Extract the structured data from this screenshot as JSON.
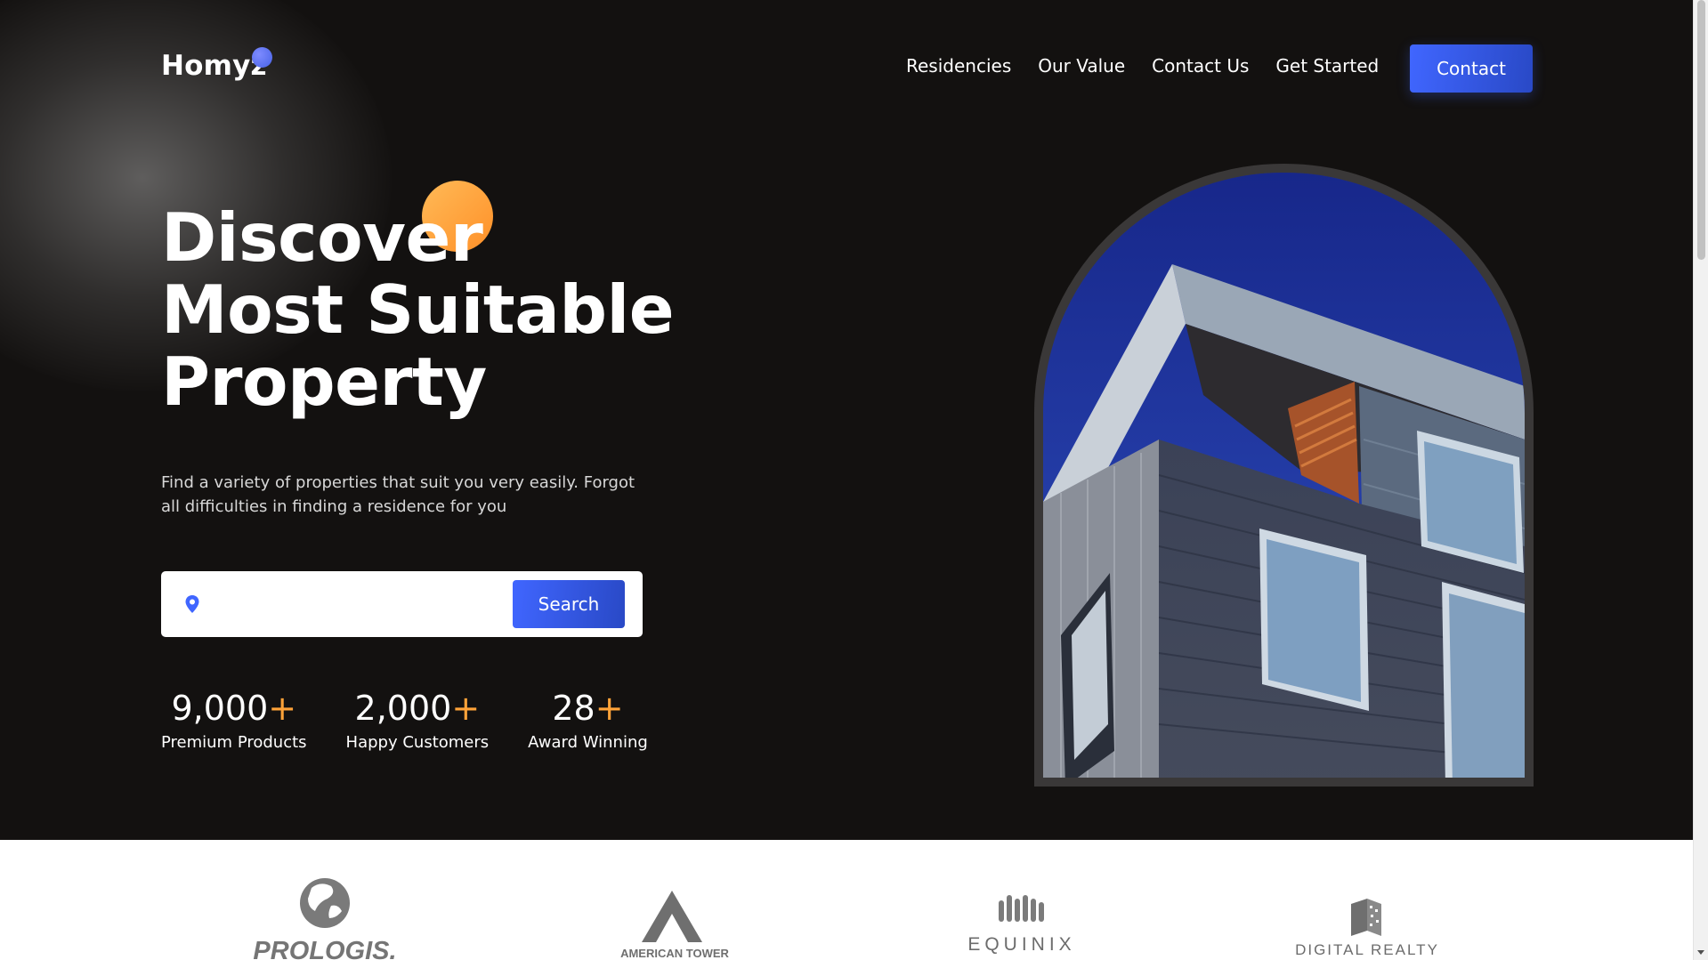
{
  "header": {
    "logo_text": "Homyz",
    "nav": [
      "Residencies",
      "Our Value",
      "Contact Us",
      "Get Started"
    ],
    "contact_label": "Contact"
  },
  "hero": {
    "title_lines": [
      "Discover",
      "Most Suitable",
      "Property"
    ],
    "subtitle": "Find a variety of properties that suit you very easily. Forgot all difficulties in finding a residence for you",
    "search": {
      "placeholder": "",
      "button_label": "Search"
    },
    "stats": [
      {
        "value": "9,000",
        "suffix": "+",
        "label": "Premium Products"
      },
      {
        "value": "2,000",
        "suffix": "+",
        "label": "Happy Customers"
      },
      {
        "value": "28",
        "suffix": "+",
        "label": "Award Winning"
      }
    ]
  },
  "companies": [
    "PROLOGIS.",
    "AMERICAN TOWER",
    "EQUINIX",
    "DIGITAL REALTY"
  ],
  "colors": {
    "background": "#131110",
    "accent_blue": "#4066ff",
    "accent_orange": "#ffa339",
    "logo_dot": "#5a72f5"
  },
  "icons": [
    "location-pin-icon"
  ]
}
